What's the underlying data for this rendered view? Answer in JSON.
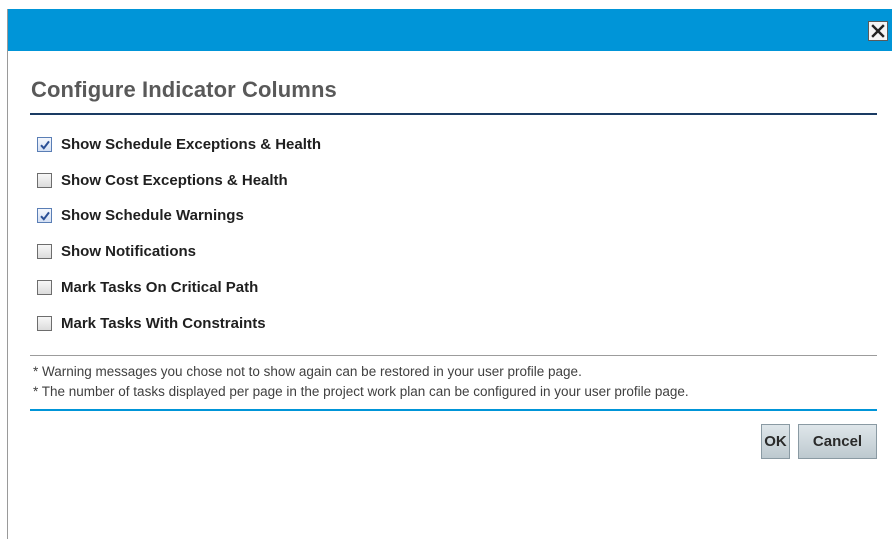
{
  "dialog": {
    "title": "Configure Indicator Columns",
    "options": [
      {
        "label": "Show Schedule Exceptions & Health",
        "checked": true
      },
      {
        "label": "Show Cost Exceptions & Health",
        "checked": false
      },
      {
        "label": "Show Schedule Warnings",
        "checked": true
      },
      {
        "label": "Show Notifications",
        "checked": false
      },
      {
        "label": "Mark Tasks On Critical Path",
        "checked": false
      },
      {
        "label": "Mark Tasks With Constraints",
        "checked": false
      }
    ],
    "notes": [
      "* Warning messages you chose not to show again can be restored in your user profile page.",
      "* The number of tasks displayed per page in the project work plan can be configured in your user profile page."
    ],
    "buttons": {
      "ok_label": "OK",
      "cancel_label": "Cancel"
    },
    "icons": {
      "close": "close-icon",
      "check": "checkmark-icon"
    },
    "colors": {
      "titlebar": "#0095d8",
      "heading_rule": "#1a3b63",
      "footer_rule": "#0095d8",
      "heading_text": "#595959",
      "button_bg": "#c9d3d8"
    }
  }
}
